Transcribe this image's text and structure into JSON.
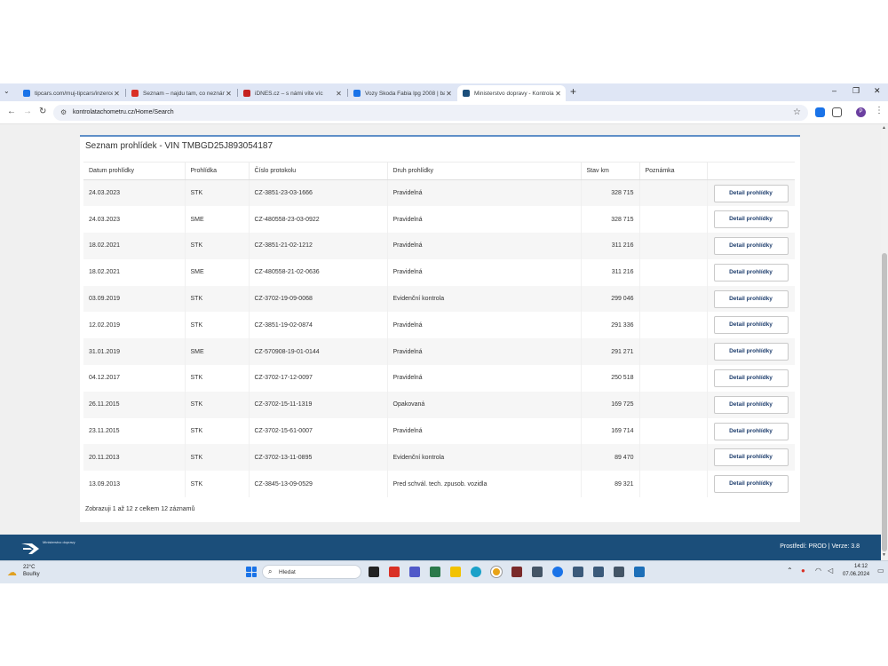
{
  "browser": {
    "tabs": [
      {
        "title": "tipcars.com/muj-tipcars/inzerce",
        "favicon_color": "#1a73e8",
        "active": false
      },
      {
        "title": "Seznam – najdu tam, co neznám",
        "favicon_color": "#d93025",
        "active": false
      },
      {
        "title": "iDNES.cz – s námi víte víc",
        "favicon_color": "#c5221f",
        "active": false
      },
      {
        "title": "Vozy Škoda Fabia lpg 2008 | baz",
        "favicon_color": "#1a73e8",
        "active": false
      },
      {
        "title": "Ministerstvo dopravy - Kontrola",
        "favicon_color": "#1b4e7a",
        "active": true
      }
    ],
    "new_tab": "+",
    "url": "kontrolatachometru.cz/Home/Search",
    "profile_initial": "P"
  },
  "page": {
    "title": "Seznam prohlídek - VIN TMBGD25J893054187",
    "columns": [
      "Datum prohlídky",
      "Prohlídka",
      "Číslo protokolu",
      "Druh prohlídky",
      "Stav km",
      "Poznámka",
      ""
    ],
    "detail_label": "Detail prohlídky",
    "rows": [
      {
        "date": "24.03.2023",
        "type": "STK",
        "protocol": "CZ-3851-23-03-1666",
        "kind": "Pravidelná",
        "km": "328 715",
        "note": ""
      },
      {
        "date": "24.03.2023",
        "type": "SME",
        "protocol": "CZ-480558-23-03-0922",
        "kind": "Pravidelná",
        "km": "328 715",
        "note": ""
      },
      {
        "date": "18.02.2021",
        "type": "STK",
        "protocol": "CZ-3851-21-02-1212",
        "kind": "Pravidelná",
        "km": "311 216",
        "note": ""
      },
      {
        "date": "18.02.2021",
        "type": "SME",
        "protocol": "CZ-480558-21-02-0636",
        "kind": "Pravidelná",
        "km": "311 216",
        "note": ""
      },
      {
        "date": "03.09.2019",
        "type": "STK",
        "protocol": "CZ-3702-19-09-0068",
        "kind": "Evidenční kontrola",
        "km": "299 046",
        "note": ""
      },
      {
        "date": "12.02.2019",
        "type": "STK",
        "protocol": "CZ-3851-19-02-0874",
        "kind": "Pravidelná",
        "km": "291 336",
        "note": ""
      },
      {
        "date": "31.01.2019",
        "type": "SME",
        "protocol": "CZ-570908-19-01-0144",
        "kind": "Pravidelná",
        "km": "291 271",
        "note": ""
      },
      {
        "date": "04.12.2017",
        "type": "STK",
        "protocol": "CZ-3702-17-12-0097",
        "kind": "Pravidelná",
        "km": "250 518",
        "note": ""
      },
      {
        "date": "26.11.2015",
        "type": "STK",
        "protocol": "CZ-3702-15-11-1319",
        "kind": "Opakovaná",
        "km": "169 725",
        "note": ""
      },
      {
        "date": "23.11.2015",
        "type": "STK",
        "protocol": "CZ-3702-15-61-0007",
        "kind": "Pravidelná",
        "km": "169 714",
        "note": ""
      },
      {
        "date": "20.11.2013",
        "type": "STK",
        "protocol": "CZ-3702-13-11-0895",
        "kind": "Evidenční kontrola",
        "km": "89 470",
        "note": ""
      },
      {
        "date": "13.09.2013",
        "type": "STK",
        "protocol": "CZ-3845-13-09-0529",
        "kind": "Pred schvál. tech. zpusob. vozidla",
        "km": "89 321",
        "note": ""
      }
    ],
    "summary": "Zobrazuji 1 až 12 z celkem 12 záznamů"
  },
  "footer": {
    "logo_text": "Ministerstvo dopravy",
    "environment": "Prostředí: PROD | Verze: 3.8"
  },
  "taskbar": {
    "weather_temp": "22°C",
    "weather_desc": "Bouřky",
    "search_placeholder": "Hledat",
    "time": "14:12",
    "date": "07.06.2024"
  },
  "colors": {
    "accent": "#5f8fc8",
    "footer": "#1b4e7a",
    "button_text": "#1f3f6e"
  }
}
